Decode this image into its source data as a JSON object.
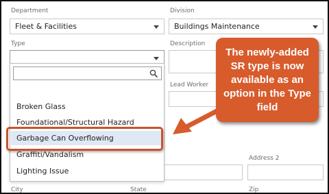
{
  "form": {
    "department": {
      "label": "Department",
      "value": "Fleet & Facilities"
    },
    "division": {
      "label": "Division",
      "value": "Buildings Maintenance"
    },
    "type": {
      "label": "Type",
      "value": ""
    },
    "description": {
      "label": "Description"
    },
    "lead_worker": {
      "label": "Lead Worker"
    },
    "address2": {
      "label": "Address 2"
    },
    "city": {
      "label": "City"
    },
    "state": {
      "label": "State"
    },
    "zip": {
      "label": "Zip"
    }
  },
  "type_dropdown": {
    "search_placeholder": "",
    "options": [
      {
        "label": ""
      },
      {
        "label": "Broken Glass"
      },
      {
        "label": "Foundational/Structural Hazard"
      },
      {
        "label": "Garbage Can Overflowing"
      },
      {
        "label": "Graffiti/Vandalism"
      },
      {
        "label": "Lighting Issue"
      }
    ],
    "highlighted_index": 3
  },
  "callout": {
    "text": "The newly-added SR type is now available as an option in the Type field"
  },
  "colors": {
    "accent_orange": "#d85b2c",
    "highlight_border": "#c8532a",
    "option_hover": "#dfe8f4"
  },
  "icons": [
    "search-icon",
    "chevron-down-icon",
    "arrow-icon"
  ]
}
